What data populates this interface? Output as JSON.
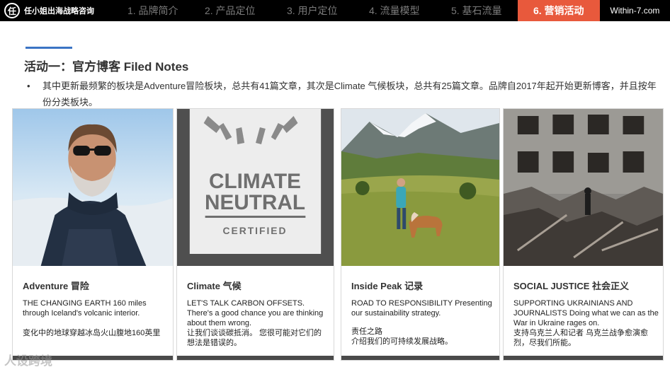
{
  "header": {
    "logo_glyph": "任",
    "brand": "任小姐出海战略咨询",
    "tabs": [
      {
        "label": "1. 品牌简介",
        "active": false
      },
      {
        "label": "2. 产品定位",
        "active": false
      },
      {
        "label": "3. 用户定位",
        "active": false
      },
      {
        "label": "4. 流量模型",
        "active": false
      },
      {
        "label": "5. 基石流量",
        "active": false
      },
      {
        "label": "6. 营销活动",
        "active": true
      }
    ],
    "site": "Within-7.com",
    "active_color": "#e8593c"
  },
  "section": {
    "title": "活动一：官方博客 Filed Notes",
    "bullet_marker": "•",
    "bullet": "其中更新最频繁的板块是Adventure冒险板块，总共有41篇文章，其次是Climate 气候板块，总共有25篇文章。品牌自2017年起开始更新博客，并且按年份分类板块。"
  },
  "cards": [
    {
      "title": "Adventure 冒险",
      "desc": "THE CHANGING EARTH 160 miles through Iceland's volcanic interior.",
      "desc_cn": "变化中的地球穿越冰岛火山腹地160英里"
    },
    {
      "title": "Climate 气候",
      "desc": "LET'S TALK CARBON OFFSETS. There's a good chance you are thinking about them wrong.",
      "desc_cn": "让我们谈谈碳抵消。 您很可能对它们的想法是错误的。",
      "image_text": [
        "CLIMATE",
        "NEUTRAL",
        "CERTIFIED"
      ]
    },
    {
      "title": "Inside Peak 记录",
      "desc": "ROAD TO RESPONSIBILITY Presenting our sustainability strategy.",
      "desc_cn": "责任之路\n介绍我们的可持续发展战略。"
    },
    {
      "title": "SOCIAL JUSTICE 社会正义",
      "desc": "SUPPORTING UKRAINIANS AND JOURNALISTS Doing what we can as the War in Ukraine rages on.",
      "desc_cn": "支持乌克兰人和记者 乌克兰战争愈演愈烈，尽我们所能。"
    }
  ],
  "watermark": "人设跨境"
}
